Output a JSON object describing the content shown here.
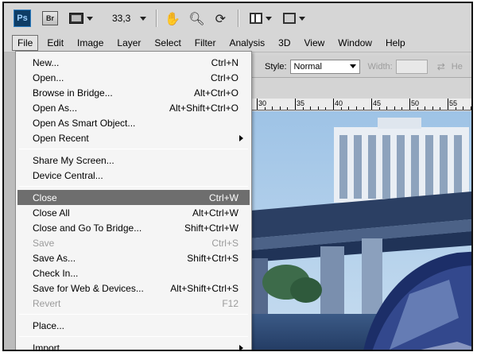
{
  "app": {
    "logo_text": "Ps",
    "bridge_text": "Br",
    "zoom": "33,3"
  },
  "menubar": {
    "items": [
      "File",
      "Edit",
      "Image",
      "Layer",
      "Select",
      "Filter",
      "Analysis",
      "3D",
      "View",
      "Window",
      "Help"
    ]
  },
  "options_bar": {
    "style_label": "Style:",
    "style_value": "Normal",
    "width_label": "Width:",
    "height_label": "He"
  },
  "ruler": {
    "labels": [
      "30",
      "35",
      "40",
      "45",
      "50",
      "55"
    ]
  },
  "file_menu": {
    "groups": [
      [
        {
          "label": "New...",
          "shortcut": "Ctrl+N"
        },
        {
          "label": "Open...",
          "shortcut": "Ctrl+O"
        },
        {
          "label": "Browse in Bridge...",
          "shortcut": "Alt+Ctrl+O"
        },
        {
          "label": "Open As...",
          "shortcut": "Alt+Shift+Ctrl+O"
        },
        {
          "label": "Open As Smart Object...",
          "shortcut": ""
        },
        {
          "label": "Open Recent",
          "shortcut": "",
          "submenu": true
        }
      ],
      [
        {
          "label": "Share My Screen...",
          "shortcut": ""
        },
        {
          "label": "Device Central...",
          "shortcut": ""
        }
      ],
      [
        {
          "label": "Close",
          "shortcut": "Ctrl+W",
          "highlight": true
        },
        {
          "label": "Close All",
          "shortcut": "Alt+Ctrl+W"
        },
        {
          "label": "Close and Go To Bridge...",
          "shortcut": "Shift+Ctrl+W"
        },
        {
          "label": "Save",
          "shortcut": "Ctrl+S",
          "disabled": true
        },
        {
          "label": "Save As...",
          "shortcut": "Shift+Ctrl+S"
        },
        {
          "label": "Check In...",
          "shortcut": ""
        },
        {
          "label": "Save for Web & Devices...",
          "shortcut": "Alt+Shift+Ctrl+S"
        },
        {
          "label": "Revert",
          "shortcut": "F12",
          "disabled": true
        }
      ],
      [
        {
          "label": "Place...",
          "shortcut": ""
        }
      ],
      [
        {
          "label": "Import",
          "shortcut": "",
          "submenu": true
        }
      ]
    ]
  },
  "colors": {
    "highlight": "#6e6e6e",
    "ps_logo_bg": "#0e3d66",
    "ps_logo_text": "#9fd2ff"
  }
}
